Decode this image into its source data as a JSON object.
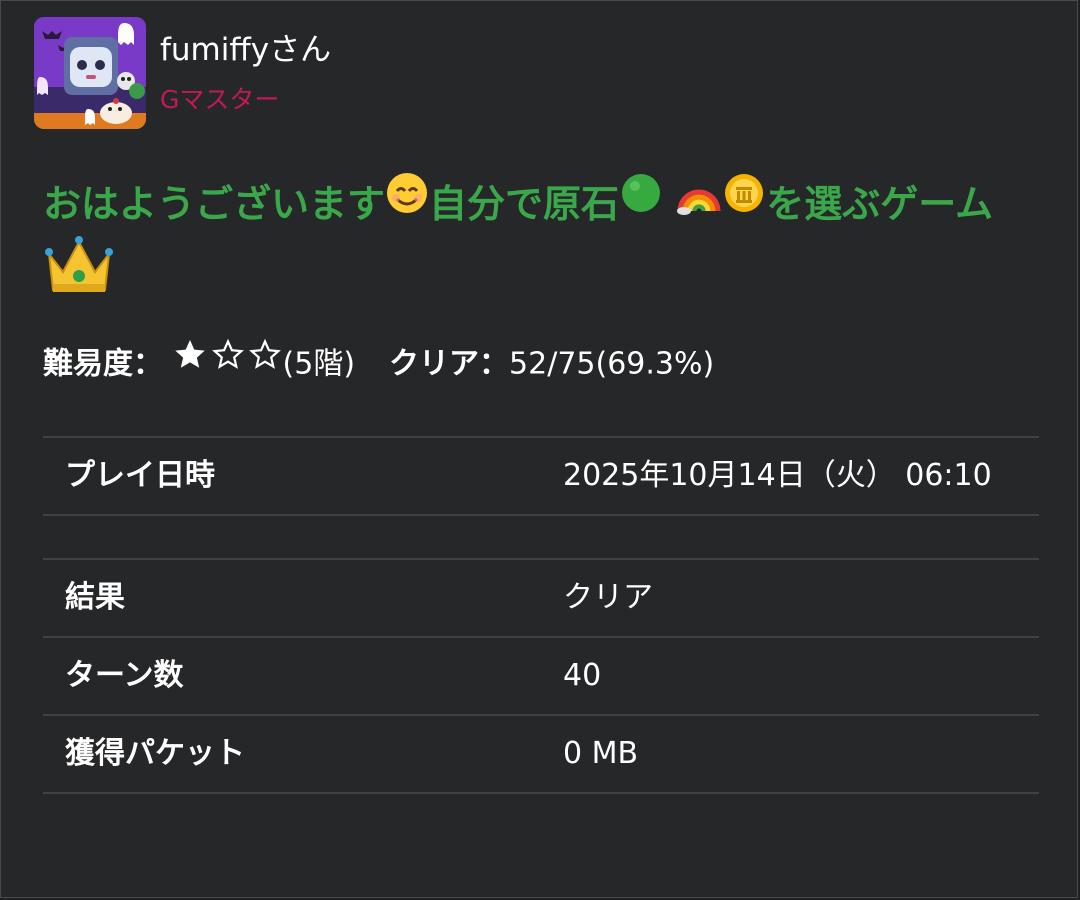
{
  "user": {
    "name": "fumiffyさん",
    "rank": "Gマスター"
  },
  "post": {
    "title_text_1": "おはようございます",
    "title_text_2": "自分で原石",
    "title_text_3": "を選ぶゲ",
    "title_text_4": "ーム"
  },
  "stats": {
    "difficulty_label": "難易度：",
    "difficulty_stars": 1,
    "difficulty_max": 3,
    "difficulty_floor": "(5階)",
    "clear_label": "クリア：",
    "clear_value": "52/75(69.3%)"
  },
  "details": [
    {
      "key": "プレイ日時",
      "value": "2025年10月14日（火） 06:10"
    },
    {
      "key": "結果",
      "value": "クリア"
    },
    {
      "key": "ターン数",
      "value": "40"
    },
    {
      "key": "獲得パケット",
      "value": "0 MB"
    }
  ],
  "colors": {
    "title": "#3aa84a",
    "rank": "#c2185b",
    "background": "#262728"
  },
  "icons": {
    "avatar": "halloween-ghost-avatar",
    "smile": "smiling-face-icon",
    "green_circle": "green-circle-icon",
    "rainbow": "rainbow-icon",
    "coin": "coin-icon",
    "crown": "crown-icon",
    "star_filled": "star-filled-icon",
    "star_empty": "star-outline-icon"
  }
}
